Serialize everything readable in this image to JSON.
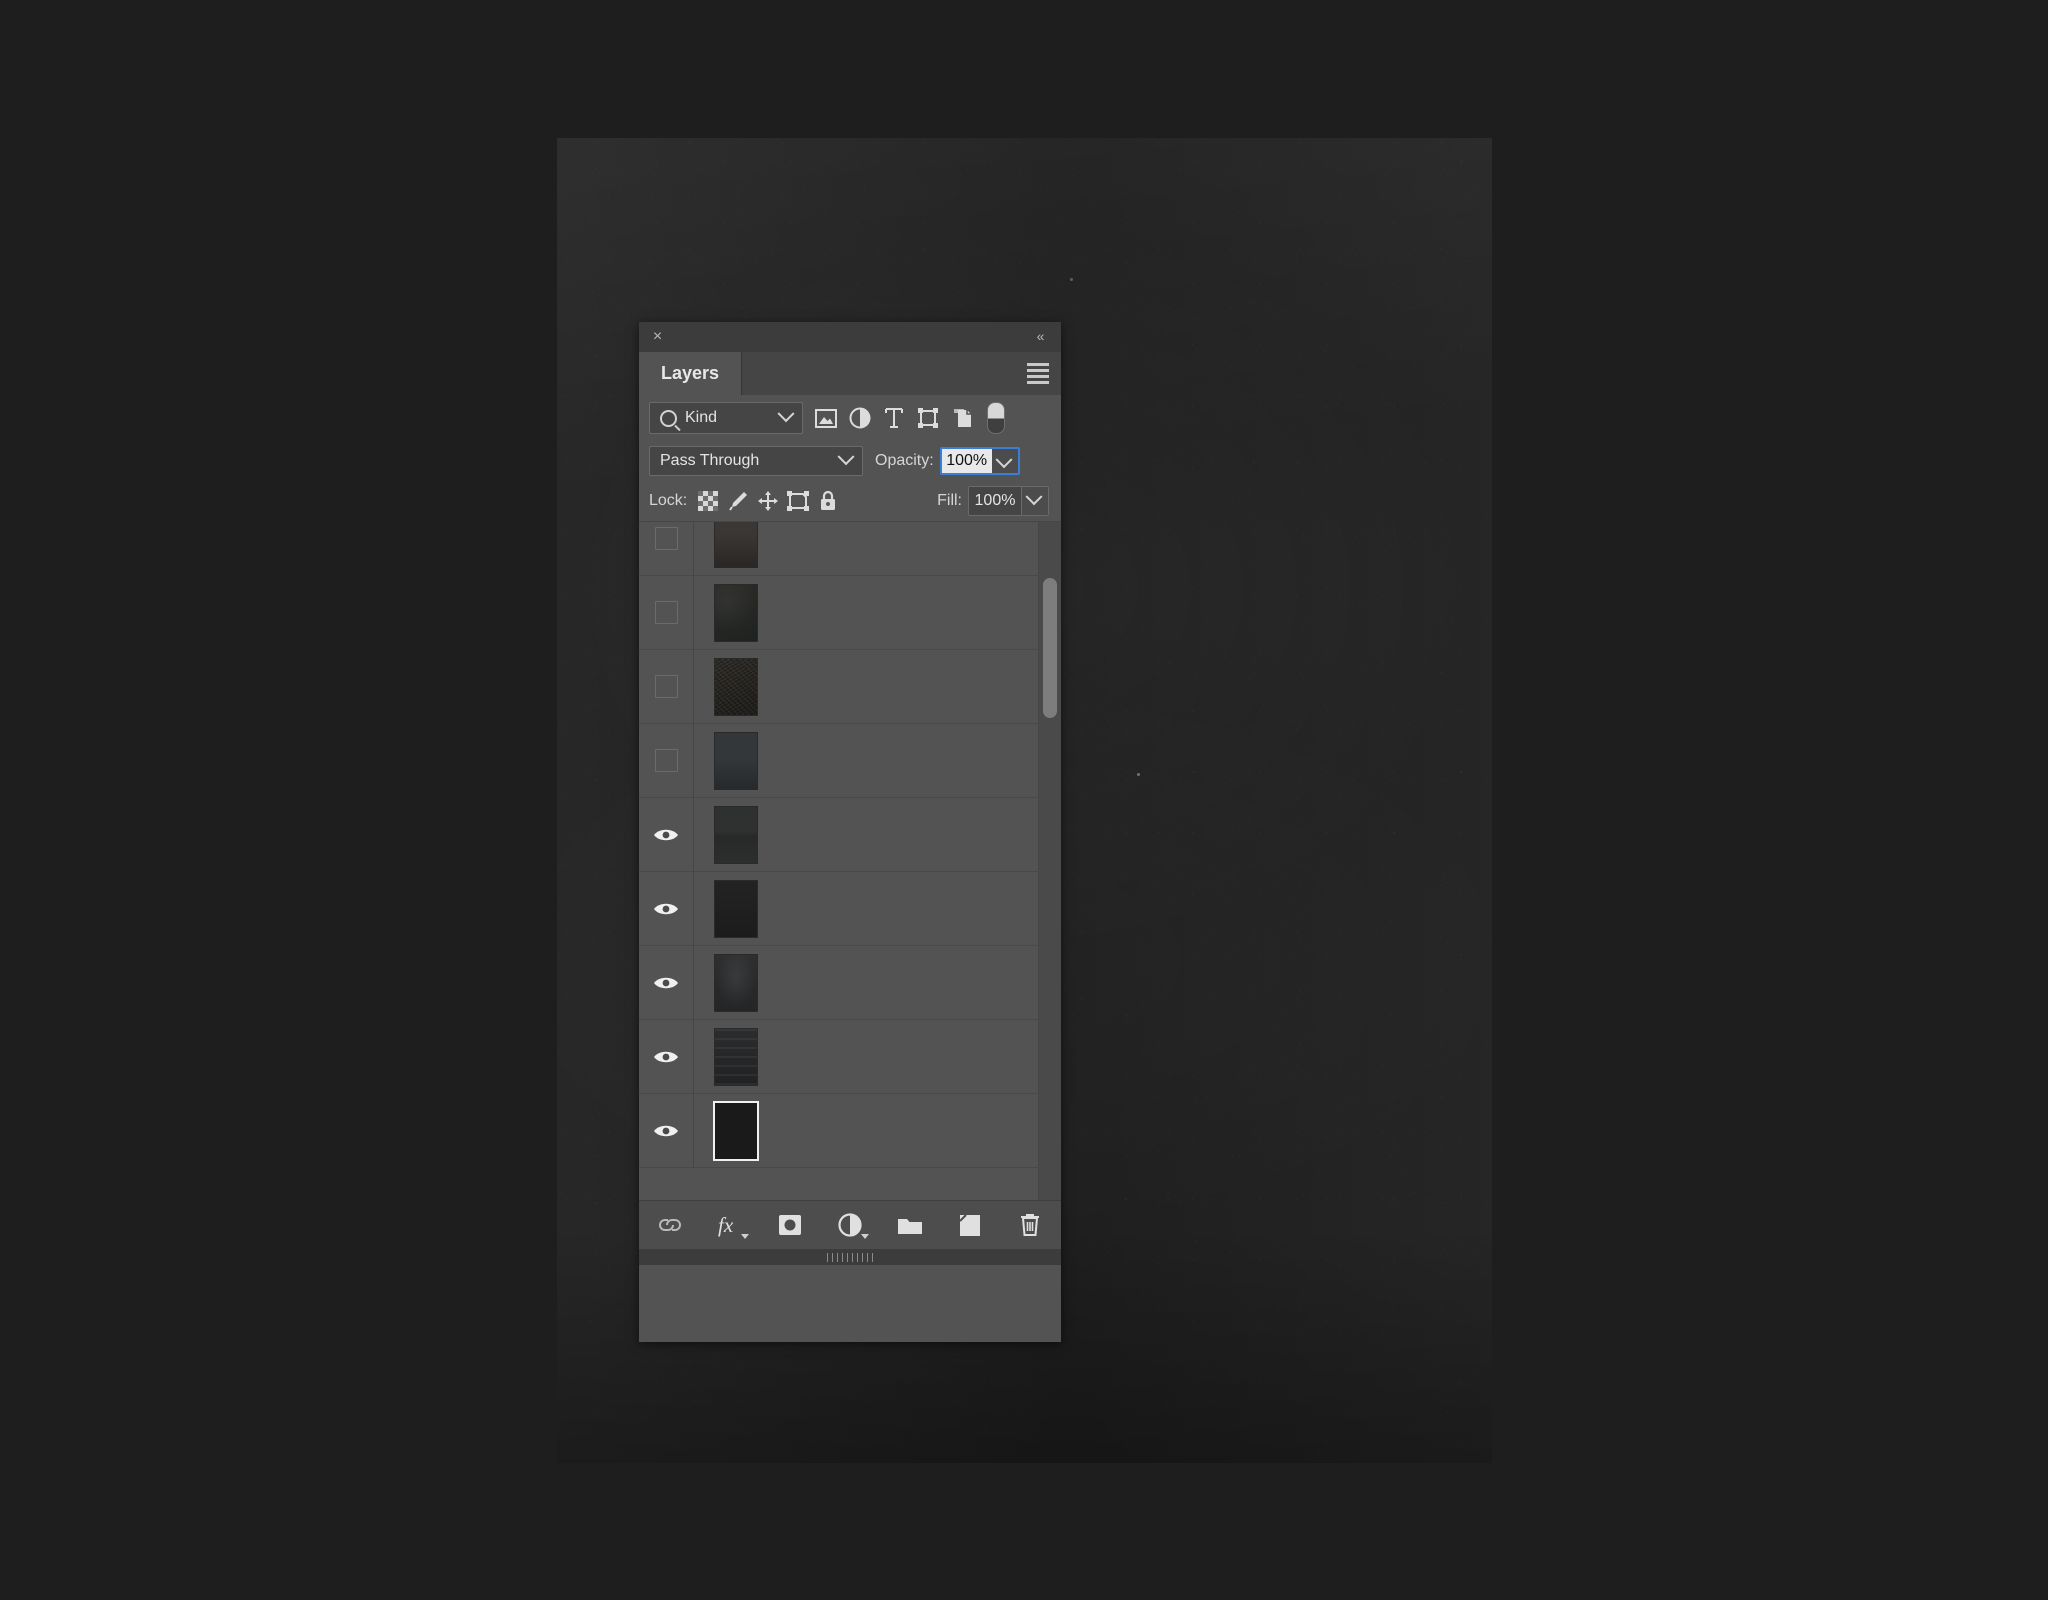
{
  "app": {
    "background_color": "#1e1e1e",
    "canvas_color": "#232323"
  },
  "panel": {
    "title": "Layers",
    "close_icon": "close-icon",
    "collapse_icon": "collapse-icon",
    "collapse_glyph": "«",
    "close_glyph": "×",
    "menu_icon": "panel-menu-icon",
    "accent_color": "#3a7fd5",
    "background_color": "#535353"
  },
  "filter": {
    "kind_label": "Kind",
    "search_icon": "search-icon",
    "caret_icon": "chevron-down-icon",
    "type_filters": [
      {
        "name": "filter-pixel-layers-icon",
        "title": "Pixel Layers"
      },
      {
        "name": "filter-adjustment-layers-icon",
        "title": "Adjustment Layers"
      },
      {
        "name": "filter-type-layers-icon",
        "title": "Type Layers"
      },
      {
        "name": "filter-shape-layers-icon",
        "title": "Shape Layers"
      },
      {
        "name": "filter-smart-objects-icon",
        "title": "Smart Objects"
      }
    ],
    "toggle_icon": "filter-enable-toggle"
  },
  "blend": {
    "mode": "Pass Through",
    "opacity_label": "Opacity:",
    "opacity_value": "100%",
    "opacity_focused": true
  },
  "lock": {
    "label": "Lock:",
    "buttons": [
      {
        "name": "lock-transparent-pixels-icon",
        "title": "Lock transparent pixels"
      },
      {
        "name": "lock-image-pixels-icon",
        "title": "Lock image pixels"
      },
      {
        "name": "lock-position-icon",
        "title": "Lock position"
      },
      {
        "name": "lock-artboard-nesting-icon",
        "title": "Prevent auto-nesting"
      },
      {
        "name": "lock-all-icon",
        "title": "Lock all"
      }
    ],
    "fill_label": "Fill:",
    "fill_value": "100%"
  },
  "layers": [
    {
      "visible": false,
      "name": "",
      "thumb": "dark-brown-texture",
      "clipped_top": true
    },
    {
      "visible": false,
      "name": "",
      "thumb": "dark-gradient-texture"
    },
    {
      "visible": false,
      "name": "",
      "thumb": "dark-mottled-texture"
    },
    {
      "visible": false,
      "name": "",
      "thumb": "dark-speckled-texture"
    },
    {
      "visible": false,
      "name": "",
      "thumb": "dark-blue-gray-texture"
    },
    {
      "visible": true,
      "name": "",
      "thumb": "dark-banded-texture"
    },
    {
      "visible": true,
      "name": "",
      "thumb": "near-black-texture"
    },
    {
      "visible": true,
      "name": "",
      "thumb": "dark-vignette-texture"
    },
    {
      "visible": true,
      "name": "",
      "thumb": "dark-striped-texture"
    },
    {
      "visible": true,
      "name": "",
      "thumb": "black-framed-fill",
      "framed": true
    }
  ],
  "layer_scrollbar": {
    "name": "layer-list-scrollbar",
    "thumb_position_percent": 8
  },
  "toolbar": {
    "buttons": [
      {
        "name": "link-layers-icon",
        "title": "Link layers"
      },
      {
        "name": "layer-style-fx-icon",
        "title": "Add a layer style",
        "has_caret": true
      },
      {
        "name": "add-layer-mask-icon",
        "title": "Add layer mask"
      },
      {
        "name": "new-adjustment-layer-icon",
        "title": "Create new fill or adjustment layer",
        "has_caret": true
      },
      {
        "name": "new-group-icon",
        "title": "Create a new group"
      },
      {
        "name": "new-layer-icon",
        "title": "Create a new layer"
      },
      {
        "name": "delete-layer-icon",
        "title": "Delete layer"
      }
    ]
  }
}
